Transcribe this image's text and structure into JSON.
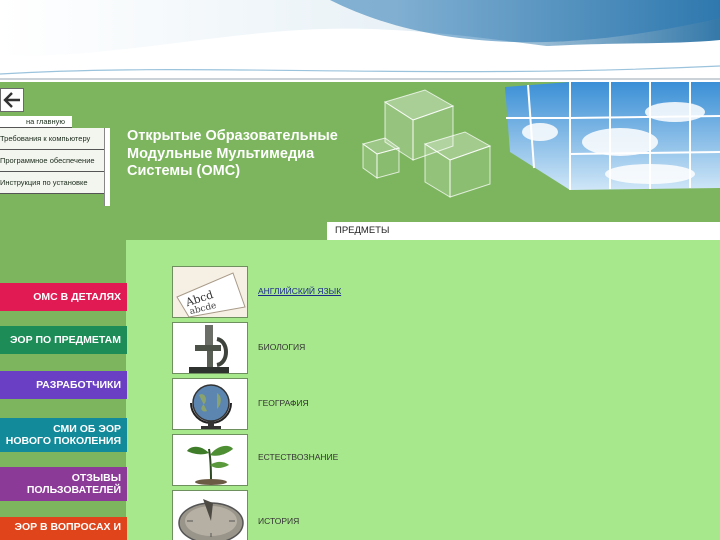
{
  "nav_utility": {
    "home_link": "на главную",
    "items": [
      "Требования к компьютеру",
      "Программное обеспечение",
      "Инструкция по установке"
    ]
  },
  "site_title": [
    "Открытые Образовательные",
    "Модульные Мультимедиа",
    "Системы (ОМС)"
  ],
  "main_nav": [
    {
      "label": "ОМС В ДЕТАЛЯХ",
      "color": "#e21a53"
    },
    {
      "label": "ЭОР ПО ПРЕДМЕТАМ",
      "color": "#1e8c57"
    },
    {
      "label": "РАЗРАБОТЧИКИ",
      "color": "#6a3fc4"
    },
    {
      "label_lines": [
        "СМИ ОБ ЭОР",
        "НОВОГО ПОКОЛЕНИЯ"
      ],
      "color": "#138a9a"
    },
    {
      "label_lines": [
        "ОТЗЫВЫ",
        "ПОЛЬЗОВАТЕЛЕЙ"
      ],
      "color": "#8b3a97"
    },
    {
      "label": "ЭОР В ВОПРОСАХ И",
      "color": "#e0441a"
    }
  ],
  "subjects": {
    "header": "ПРЕДМЕТЫ",
    "items": [
      {
        "label": "АНГЛИЙСКИЙ ЯЗЫК",
        "icon": "notebook-letters-icon",
        "link": true
      },
      {
        "label": "БИОЛОГИЯ",
        "icon": "microscope-icon",
        "link": false
      },
      {
        "label": "ГЕОГРАФИЯ",
        "icon": "globe-icon",
        "link": false
      },
      {
        "label": "ЕСТЕСТВОЗНАНИЕ",
        "icon": "sprout-icon",
        "link": false
      },
      {
        "label": "ИСТОРИЯ",
        "icon": "sundial-icon",
        "link": false
      }
    ]
  },
  "colors": {
    "site_background": "#7cb55e",
    "panel_background": "#a8e88c",
    "link": "#1a2a8a"
  }
}
